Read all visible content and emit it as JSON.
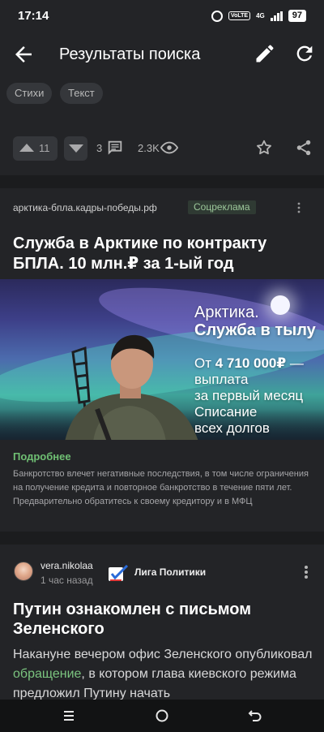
{
  "status_bar": {
    "time": "17:14",
    "volte": "VoLTE",
    "network": "4G",
    "battery": "97"
  },
  "app_bar": {
    "title": "Результаты поиска",
    "back_icon": "arrow-left-icon",
    "edit_icon": "pencil-icon",
    "refresh_icon": "refresh-icon"
  },
  "tags": [
    "Стихи",
    "Текст"
  ],
  "post_actions": {
    "upvotes": "11",
    "comments": "3",
    "views": "2.3K"
  },
  "ad": {
    "domain": "арктика-бпла.кадры-победы.рф",
    "badge": "Соцреклама",
    "title": "Служба в Арктике по контракту БПЛА. 10 млн.₽ за 1-ый год",
    "banner": {
      "line1": "Арктика.",
      "line2": "Служба в тылу",
      "line3_prefix": "От ",
      "line3_amount": "4 710 000₽",
      "line3_suffix": " —",
      "line4": "выплата",
      "line5": "за первый месяц",
      "line6": "Списание",
      "line7": "всех долгов"
    },
    "more_link": "Подробнее",
    "disclaimer": "Банкротство влечет негативные последствия, в том числе ограничения на получение кредита и повторное банкротство в течение пяти лет. Предварительно обратитесь к своему кредитору и в МФЦ"
  },
  "post": {
    "author": "vera.nikolaa",
    "time": "1 час назад",
    "community": "Лига Политики",
    "title": "Путин ознакомлен с письмом Зеленского",
    "text_before": "Накануне вечером офис Зеленского опубликовал ",
    "text_link": "обращение",
    "text_after": ", в котором глава киевского режима предложил Путину начать"
  },
  "colors": {
    "background": "#1b1c1e",
    "card": "#232427",
    "accent_green": "#6fbf73",
    "chip": "#35373b"
  }
}
